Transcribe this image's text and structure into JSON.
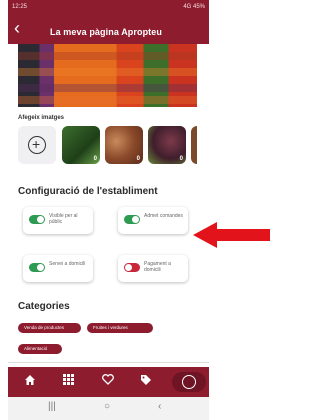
{
  "status_bar": {
    "time": "12:25",
    "right": "4G 45%"
  },
  "header": {
    "title": "La meva pàgina Apropteu"
  },
  "images": {
    "label": "Afegeix imatges",
    "thumbs": [
      {
        "count": "0"
      },
      {
        "count": "0"
      },
      {
        "count": "0"
      },
      {
        "count": "0"
      }
    ]
  },
  "settings": {
    "title": "Configuració de l'establiment",
    "items": [
      {
        "label": "Visible per al públic",
        "on": true
      },
      {
        "label": "Admet comandes",
        "on": true
      },
      {
        "label": "Servei a domicili",
        "on": true
      },
      {
        "label": "Pagament a domicili",
        "on": false
      }
    ]
  },
  "categories": {
    "title": "Categories",
    "chips": [
      "Venda de productes",
      "Fruites i verdures",
      "Alimentació"
    ]
  },
  "bottom_nav": [
    "home-icon",
    "grid-icon",
    "heart-icon",
    "tag-icon",
    "profile-icon"
  ],
  "colors": {
    "brand": "#8e1c2f",
    "toggle_on": "#2e9a52",
    "toggle_off": "#c9283b",
    "arrow": "#e3131b"
  }
}
